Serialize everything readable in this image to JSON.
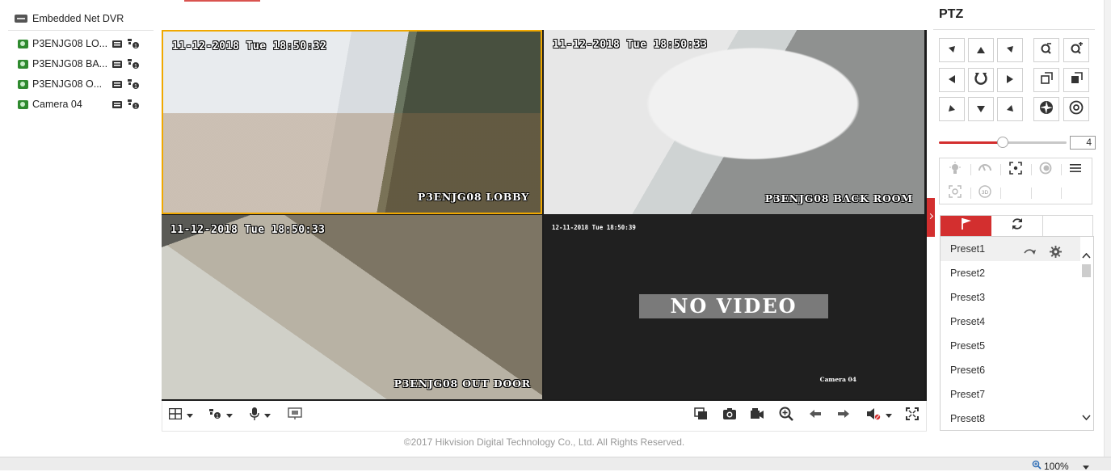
{
  "device_tree": {
    "dvr_label": "Embedded Net DVR",
    "cameras": [
      {
        "label": "P3ENJG08 LO..."
      },
      {
        "label": "P3ENJG08 BA..."
      },
      {
        "label": "P3ENJG08 O..."
      },
      {
        "label": "Camera 04"
      }
    ]
  },
  "video": {
    "tiles": [
      {
        "timestamp": "11-12-2018 Tue 18:50:32",
        "name": "P3ENJG08 LOBBY"
      },
      {
        "timestamp": "11-12-2018 Tue 18:50:33",
        "name": "P3ENJG08 BACK ROOM"
      },
      {
        "timestamp": "11-12-2018 Tue 18:50:33",
        "name": "P3ENJG08 OUT DOOR"
      },
      {
        "timestamp": "12-11-2018 Tue 18:50:39",
        "name": "Camera 04",
        "overlay": "NO VIDEO"
      }
    ]
  },
  "footer": {
    "copyright": "©2017 Hikvision Digital Technology Co., Ltd. All Rights Reserved."
  },
  "ptz": {
    "title": "PTZ",
    "speed": "4",
    "speed_level": 0.5,
    "presets": [
      "Preset1",
      "Preset2",
      "Preset3",
      "Preset4",
      "Preset5",
      "Preset6",
      "Preset7",
      "Preset8"
    ]
  },
  "status_bar": {
    "zoom": "100%"
  },
  "colors": {
    "accent": "#d32f2f",
    "active_tile_border": "#f0a800"
  },
  "icons": [
    "dvr-icon",
    "camera-status-icon",
    "record-icon",
    "ptz-icon",
    "arrow-icons",
    "zoom-icons",
    "focus-icons",
    "iris-icons",
    "preset-flag-icon",
    "patrol-icon",
    "call-preset-icon",
    "gear-icon",
    "layout-icon",
    "mic-icon",
    "capture-icon",
    "record-clip-icon",
    "digital-zoom-icon",
    "volume-mute-icon",
    "fullscreen-icon"
  ]
}
